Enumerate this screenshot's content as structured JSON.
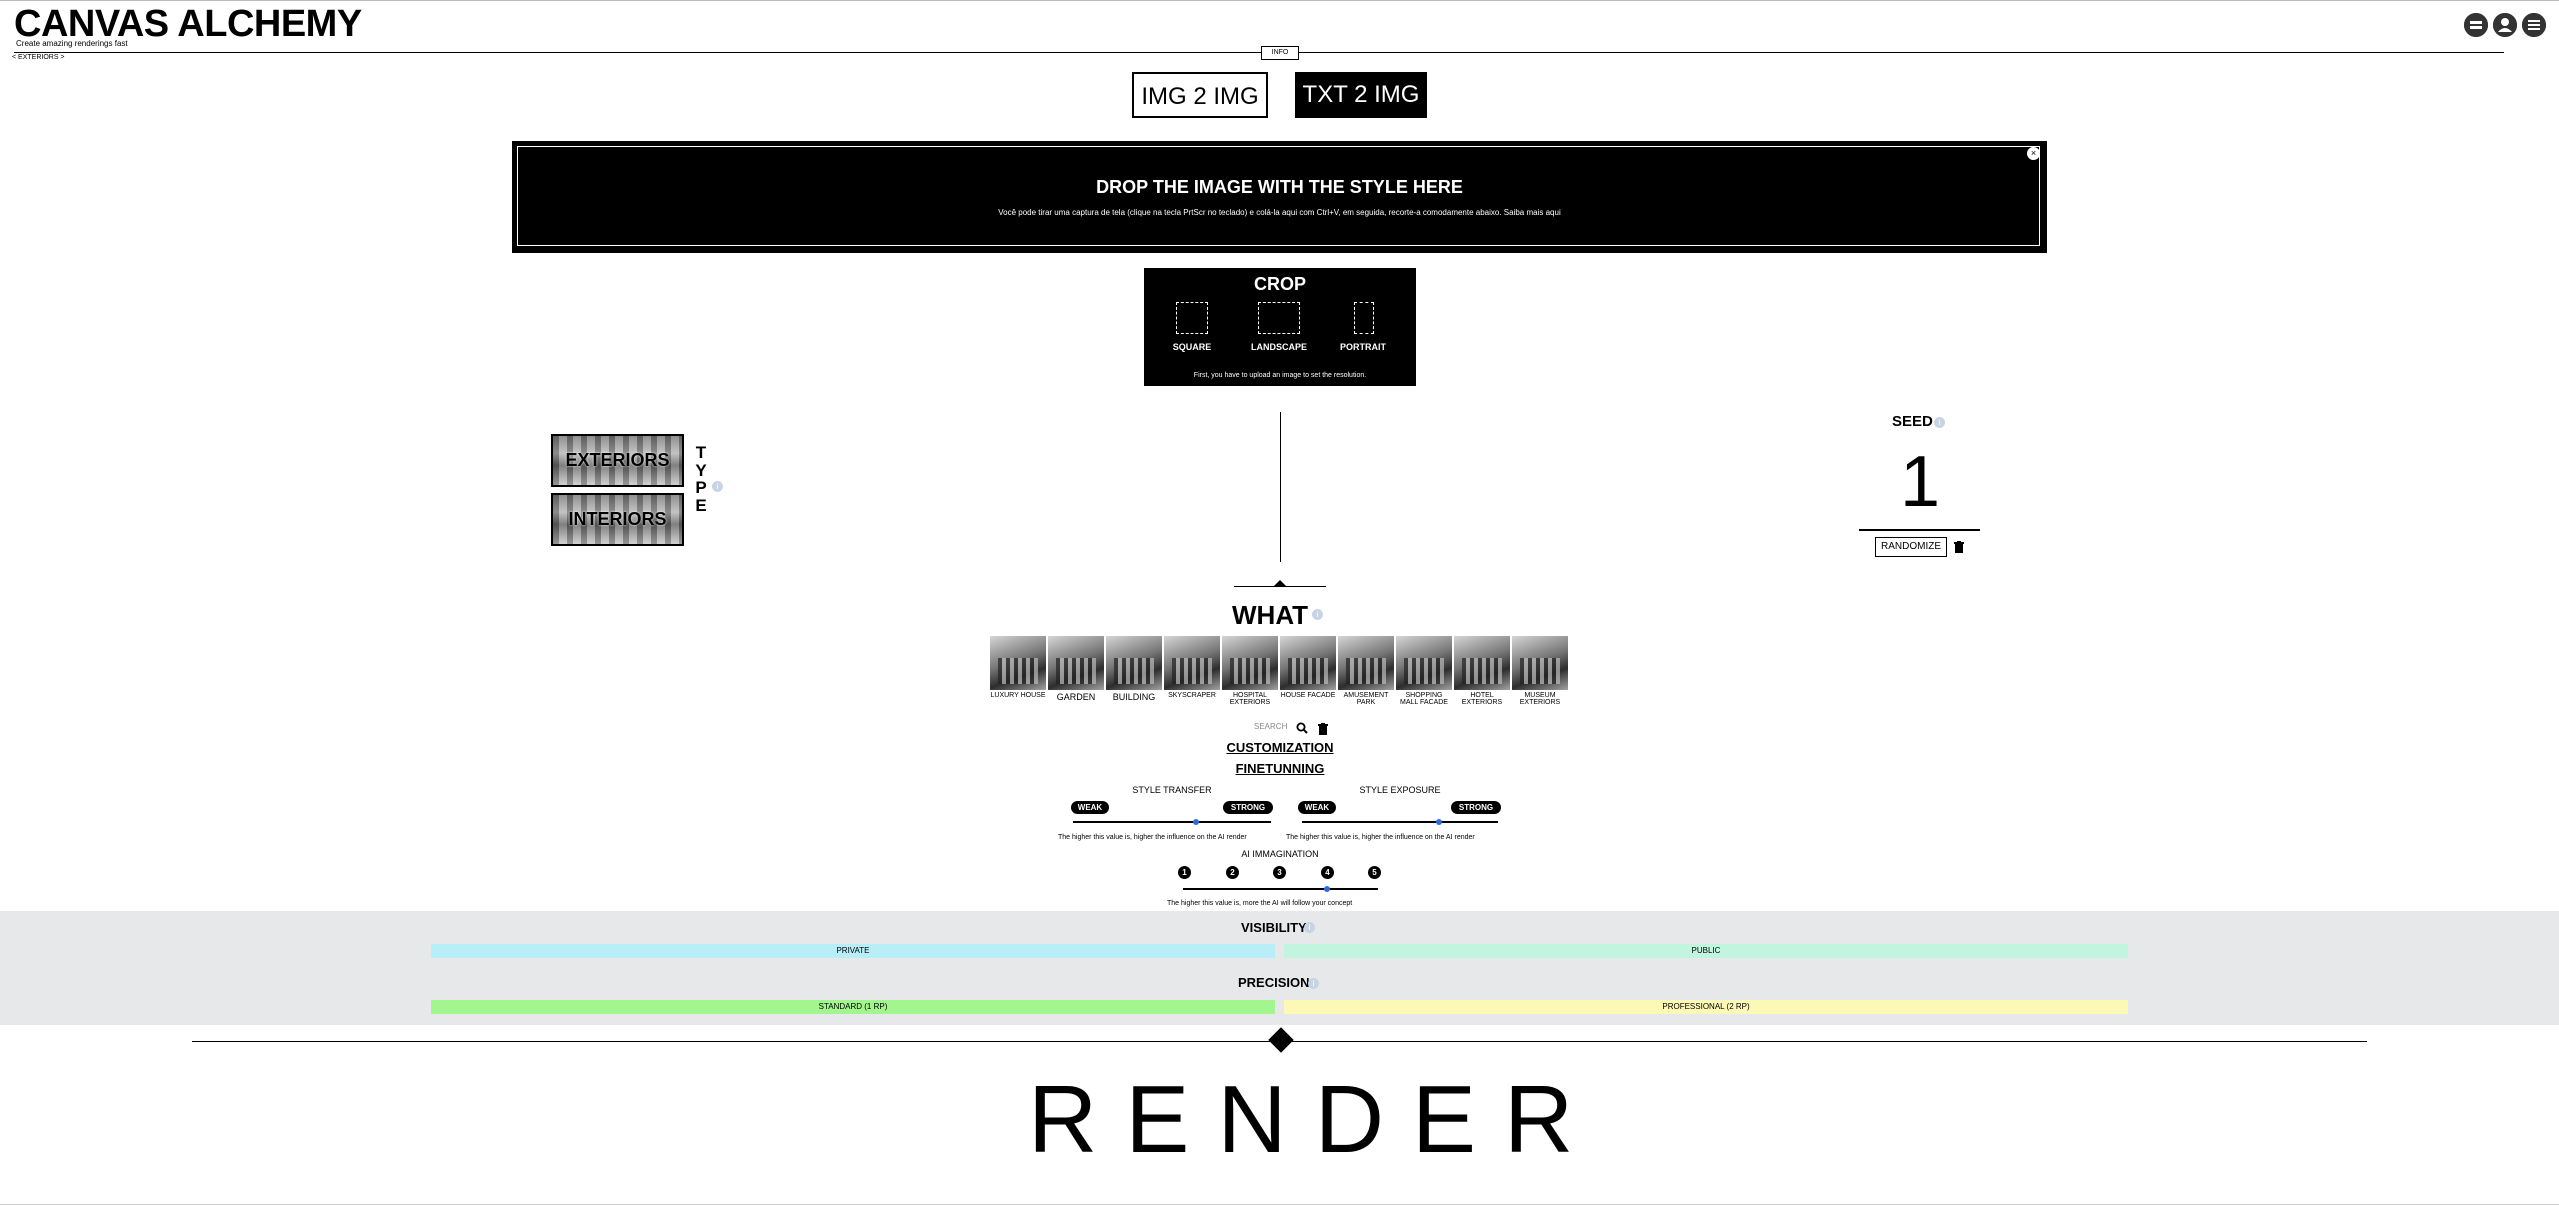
{
  "brand": {
    "title": "CANVAS ALCHEMY",
    "subtitle": "Create amazing renderings fast"
  },
  "header": {
    "info_label": "INFO",
    "breadcrumb": "< EXTERIORS >"
  },
  "header_icons": [
    "layers-icon",
    "user-icon",
    "menu-icon"
  ],
  "modes": {
    "img2img": "IMG 2 IMG",
    "txt2img": "TXT 2 IMG",
    "active": "TXT 2 IMG"
  },
  "drop": {
    "title": "DROP THE IMAGE WITH THE STYLE HERE",
    "text": "Você pode tirar uma captura de tela (clique na tecla PrtScr no teclado) e colá-la aqui com Ctrl+V, em seguida, recorte-a comodamente abaixo. Saiba mais aqui",
    "close": "×"
  },
  "crop": {
    "title": "CROP",
    "options": [
      "SQUARE",
      "LANDSCAPE",
      "PORTRAIT"
    ],
    "note": "First, you have to upload an image to set the resolution."
  },
  "type": {
    "letters": [
      "T",
      "Y",
      "P",
      "E"
    ],
    "options": [
      "EXTERIORS",
      "INTERIORS"
    ],
    "selected": "EXTERIORS"
  },
  "seed": {
    "label": "SEED",
    "value": "1",
    "randomize": "RANDOMIZE"
  },
  "what": {
    "title": "WHAT",
    "items": [
      "LUXURY HOUSE",
      "GARDEN",
      "BUILDING",
      "SKYSCRAPER",
      "HOSPITAL EXTERIORS",
      "HOUSE FACADE",
      "AMUSEMENT PARK",
      "SHOPPING MALL FACADE",
      "HOTEL EXTERIORS",
      "MUSEUM EXTERIORS"
    ],
    "search_placeholder": "SEARCH"
  },
  "customization": {
    "title": "CUSTOMIZATION",
    "finetuning": "FINETUNNING"
  },
  "style_transfer": {
    "title": "STYLE TRANSFER",
    "weak": "WEAK",
    "strong": "STRONG",
    "value": 0.62,
    "note": "The higher this value is, higher the influence on the AI render"
  },
  "style_exposure": {
    "title": "STYLE EXPOSURE",
    "weak": "WEAK",
    "strong": "STRONG",
    "value": 0.7,
    "note": "The higher this value is, higher the influence on the AI render"
  },
  "ai_imagination": {
    "title": "AI IMMAGINATION",
    "levels": [
      "1",
      "2",
      "3",
      "4",
      "5"
    ],
    "selected": "4",
    "note": "The higher this value is, more the AI will follow your concept"
  },
  "visibility": {
    "title": "VISIBILITY",
    "options": [
      "PRIVATE",
      "PUBLIC"
    ]
  },
  "precision": {
    "title": "PRECISION",
    "options": [
      "STANDARD (1 RP)",
      "PROFESSIONAL (2 RP)"
    ]
  },
  "render": {
    "label": "RENDER"
  },
  "colors": {
    "private": "#b7eef7",
    "public": "#c2f5e0",
    "standard": "#a3f58e",
    "professional": "#fbf9b5",
    "band": "#e6e8ea",
    "knob": "#2d6be0"
  }
}
